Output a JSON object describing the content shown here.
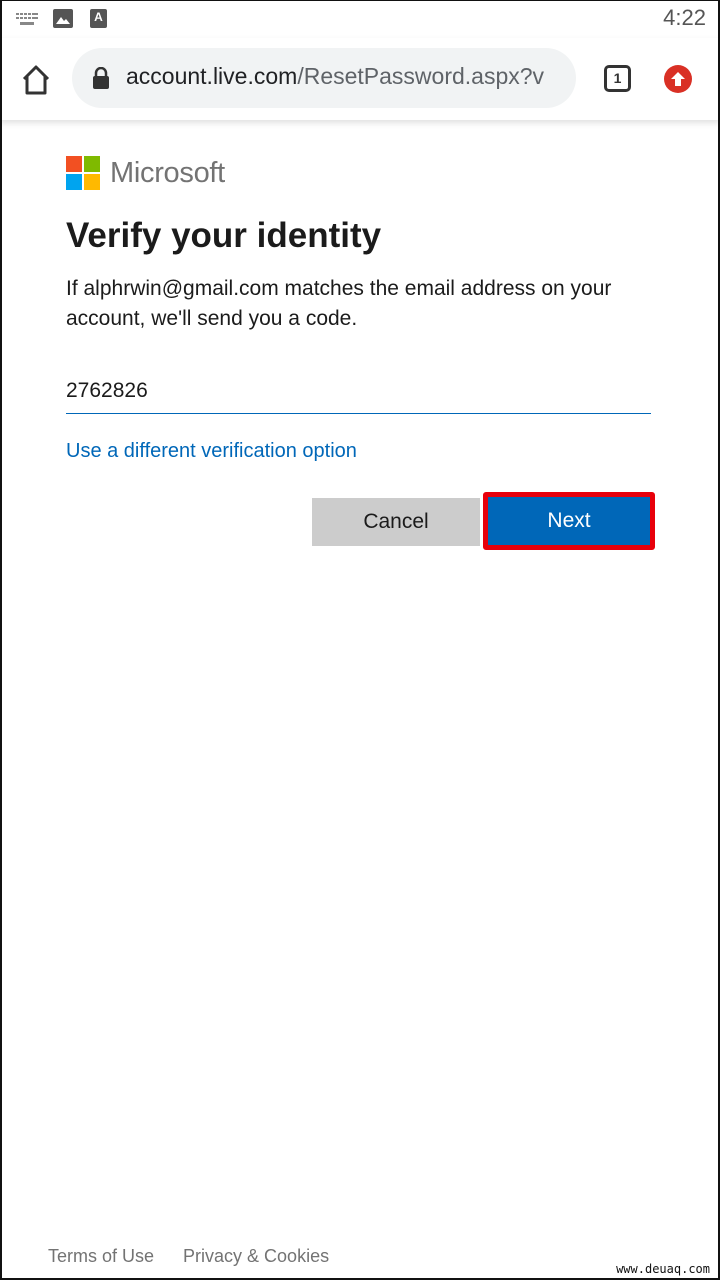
{
  "status_bar": {
    "time": "4:22",
    "icons": [
      "keyboard-icon",
      "image-icon",
      "text-a-icon"
    ],
    "text_icon_letter": "A"
  },
  "browser": {
    "url_host": "account.live.com",
    "url_path": "/ResetPassword.aspx?v",
    "tab_count": "1",
    "icons": [
      "home-icon",
      "lock-icon",
      "tab-switcher-icon",
      "update-icon"
    ]
  },
  "page": {
    "brand": "Microsoft",
    "brand_colors": {
      "red": "#f25022",
      "green": "#7fba00",
      "blue": "#00a4ef",
      "yellow": "#ffb900"
    },
    "title": "Verify your identity",
    "description": "If alphrwin@gmail.com matches the email address on your account, we'll send you a code.",
    "code_input": {
      "value": "2762826",
      "placeholder": ""
    },
    "alt_option_link": "Use a different verification option",
    "buttons": {
      "cancel": "Cancel",
      "next": "Next"
    },
    "accent_color": "#0067b8",
    "highlight_color": "#e8000b"
  },
  "footer": {
    "links": [
      "Terms of Use",
      "Privacy & Cookies"
    ]
  },
  "watermark": "www.deuaq.com"
}
